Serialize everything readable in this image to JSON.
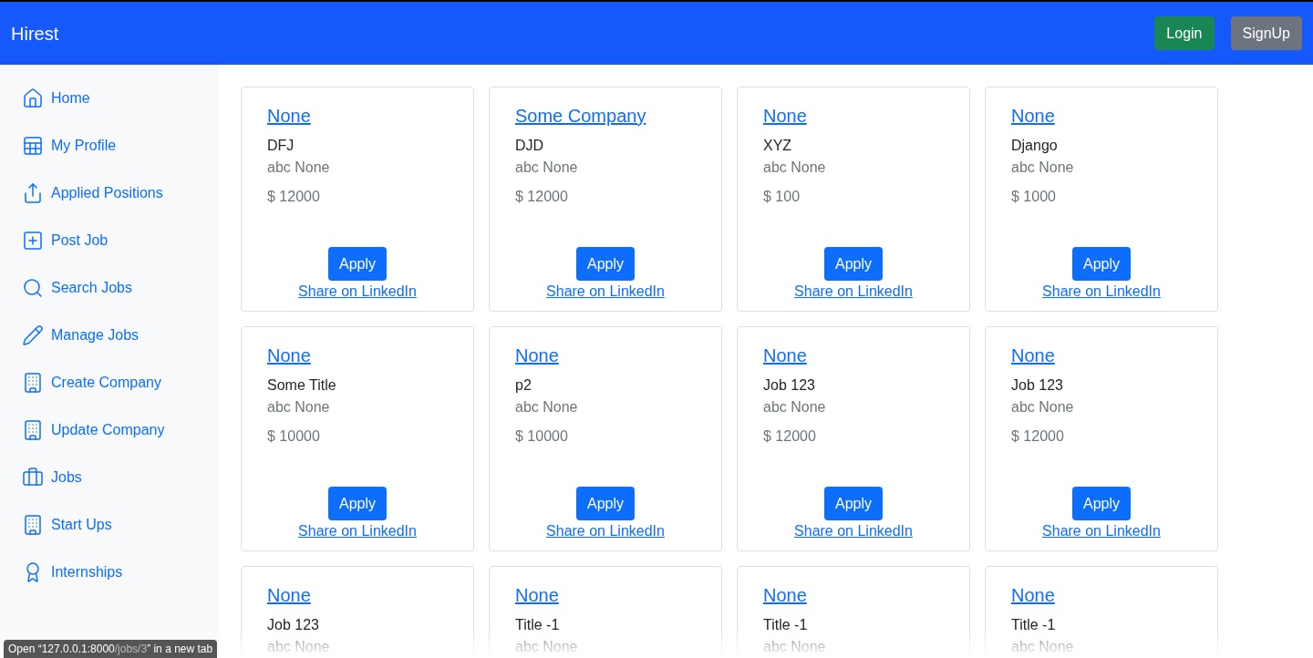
{
  "navbar": {
    "brand": "Hirest",
    "buttons": [
      {
        "label": "Login",
        "kind": "success"
      },
      {
        "label": "SignUp",
        "kind": "secondary"
      }
    ]
  },
  "sidebar": {
    "items": [
      {
        "label": "Home",
        "kind": "home"
      },
      {
        "label": "My Profile",
        "kind": "table"
      },
      {
        "label": "Applied Positions",
        "kind": "upload"
      },
      {
        "label": "Post Job",
        "kind": "plus"
      },
      {
        "label": "Search Jobs",
        "kind": "search"
      },
      {
        "label": "Manage Jobs",
        "kind": "pencil"
      },
      {
        "label": "Create Company",
        "kind": "building"
      },
      {
        "label": "Update Company",
        "kind": "building"
      },
      {
        "label": "Jobs",
        "kind": "briefcase"
      },
      {
        "label": "Start Ups",
        "kind": "building"
      },
      {
        "label": "Internships",
        "kind": "award"
      }
    ]
  },
  "jobs": [
    {
      "company": "None",
      "title": "DFJ",
      "location": "abc None",
      "salary": "$ 12000",
      "apply": "Apply",
      "share": "Share on LinkedIn"
    },
    {
      "company": "Some Company",
      "title": "DJD",
      "location": "abc None",
      "salary": "$ 12000",
      "apply": "Apply",
      "share": "Share on LinkedIn"
    },
    {
      "company": "None",
      "title": "XYZ",
      "location": "abc None",
      "salary": "$ 100",
      "apply": "Apply",
      "share": "Share on LinkedIn"
    },
    {
      "company": "None",
      "title": "Django",
      "location": "abc None",
      "salary": "$ 1000",
      "apply": "Apply",
      "share": "Share on LinkedIn"
    },
    {
      "company": "None",
      "title": "Some Title",
      "location": "abc None",
      "salary": "$ 10000",
      "apply": "Apply",
      "share": "Share on LinkedIn"
    },
    {
      "company": "None",
      "title": "p2",
      "location": "abc None",
      "salary": "$ 10000",
      "apply": "Apply",
      "share": "Share on LinkedIn"
    },
    {
      "company": "None",
      "title": "Job 123",
      "location": "abc None",
      "salary": "$ 12000",
      "apply": "Apply",
      "share": "Share on LinkedIn"
    },
    {
      "company": "None",
      "title": "Job 123",
      "location": "abc None",
      "salary": "$ 12000",
      "apply": "Apply",
      "share": "Share on LinkedIn"
    },
    {
      "company": "None",
      "title": "Job 123",
      "location": "abc None"
    },
    {
      "company": "None",
      "title": "Title -1",
      "location": "abc None"
    },
    {
      "company": "None",
      "title": "Title -1",
      "location": "abc None"
    },
    {
      "company": "None",
      "title": "Title -1",
      "location": "abc None"
    }
  ],
  "status_bar": {
    "before": "Open “127.0.0.1:8000",
    "path": "/jobs/3",
    "after": "” in a new tab"
  }
}
